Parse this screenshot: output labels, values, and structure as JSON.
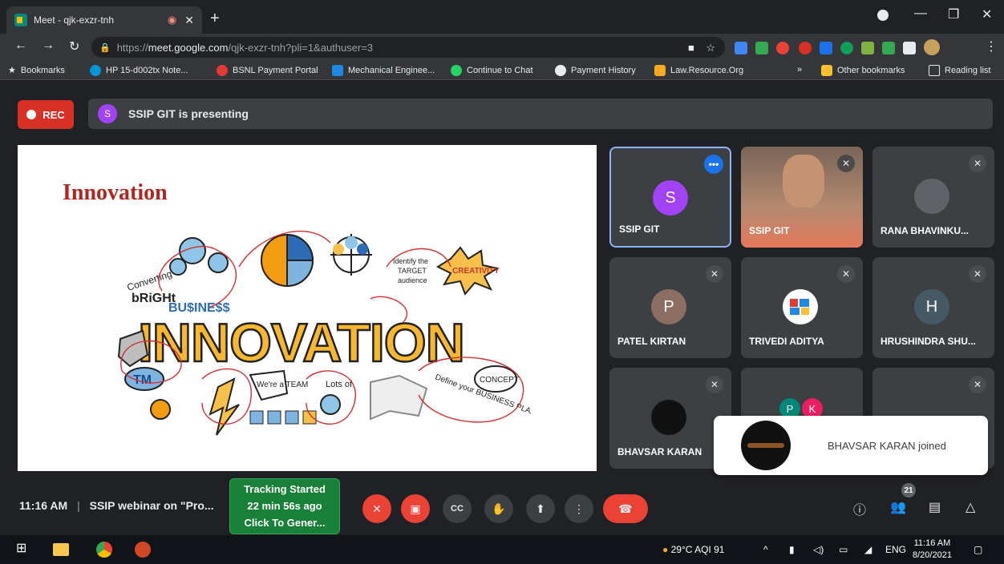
{
  "browser": {
    "tab_title": "Meet - qjk-exzr-tnh",
    "tab_recording_icon": "record-icon",
    "url_scheme": "https://",
    "url_domain": "meet.google.com",
    "url_path": "/qjk-exzr-tnh?pli=1&authuser=3"
  },
  "bookmarks": [
    {
      "label": "Bookmarks",
      "icon": "star-icon",
      "color": "#e8eaed"
    },
    {
      "label": "HP 15-d002tx Note...",
      "icon": "hp-icon",
      "color": "#0096d6"
    },
    {
      "label": "BSNL Payment Portal",
      "icon": "bsnl-icon",
      "color": "#e53935"
    },
    {
      "label": "Mechanical Enginee...",
      "icon": "trello-icon",
      "color": "#1e88e5"
    },
    {
      "label": "Continue to Chat",
      "icon": "whatsapp-icon",
      "color": "#25d366"
    },
    {
      "label": "Payment History",
      "icon": "globe-icon",
      "color": "#e8eaed"
    },
    {
      "label": "Law.Resource.Org",
      "icon": "law-icon",
      "color": "#f9a825"
    },
    {
      "label": "Other bookmarks",
      "icon": "folder-icon",
      "color": "#fbc02d"
    },
    {
      "label": "Reading list",
      "icon": "reading-list-icon",
      "color": "#e8eaed"
    }
  ],
  "meeting": {
    "rec_label": "REC",
    "presenter_initial": "S",
    "presenting_text": "SSIP GIT is presenting",
    "slide_title": "Innovation",
    "time": "11:16 AM",
    "meeting_title": "SSIP webinar on \"Pro...",
    "tracking": [
      "Tracking Started",
      "22 min 56s ago",
      "Click To Gener..."
    ],
    "participant_count": "21",
    "toast_text": "BHAVSAR KARAN joined"
  },
  "participants": [
    {
      "name": "SSIP GIT",
      "initial": "S",
      "color": "#a142f4"
    },
    {
      "name": "SSIP GIT",
      "initial": "",
      "color": ""
    },
    {
      "name": "RANA BHAVINKU...",
      "initial": "",
      "color": "#5f6368"
    },
    {
      "name": "PATEL KIRTAN",
      "initial": "P",
      "color": "#8d6e63"
    },
    {
      "name": "TRIVEDI ADITYA",
      "initial": "",
      "color": "#ffffff"
    },
    {
      "name": "HRUSHINDRA SHU...",
      "initial": "H",
      "color": "#455a64"
    },
    {
      "name": "BHAVSAR KARAN",
      "initial": "",
      "color": "#111111"
    },
    {
      "name": "",
      "initial": "P",
      "color": "#00897b"
    },
    {
      "name": "",
      "initial": "K",
      "color": "#e91e63"
    }
  ],
  "taskbar": {
    "weather": "29°C AQI 91",
    "language": "ENG",
    "clock_time": "11:16 AM",
    "clock_date": "8/20/2021"
  }
}
